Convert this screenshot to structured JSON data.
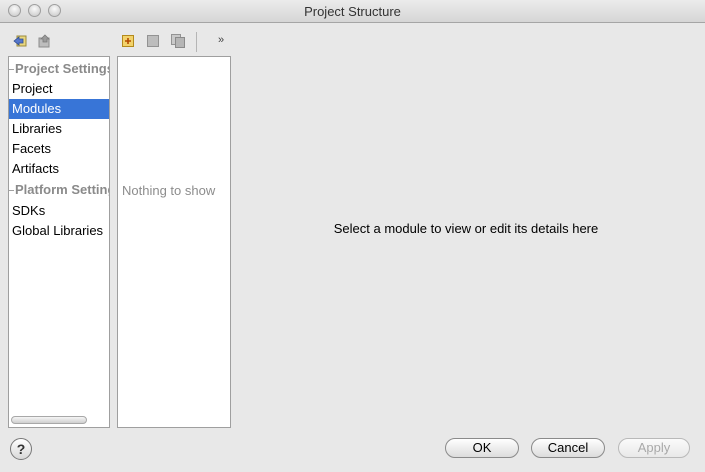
{
  "window": {
    "title": "Project Structure"
  },
  "left_toolbar": {
    "icons": [
      "back-icon",
      "forward-icon"
    ]
  },
  "modules_toolbar": {
    "icons": [
      "add-icon",
      "remove-icon",
      "copy-icon"
    ],
    "more_label": "»"
  },
  "sidebar": {
    "groups": [
      {
        "label": "Project Settings",
        "items": [
          "Project",
          "Modules",
          "Libraries",
          "Facets",
          "Artifacts"
        ]
      },
      {
        "label": "Platform Settings",
        "items": [
          "SDKs",
          "Global Libraries"
        ]
      }
    ],
    "selected": "Modules"
  },
  "modules_list": {
    "empty_text": "Nothing to show"
  },
  "details": {
    "placeholder": "Select a module to view or edit its details here"
  },
  "footer": {
    "help_label": "?",
    "ok_label": "OK",
    "cancel_label": "Cancel",
    "apply_label": "Apply"
  },
  "colors": {
    "selection": "#3875d7",
    "window_bg": "#e8e8e8"
  }
}
